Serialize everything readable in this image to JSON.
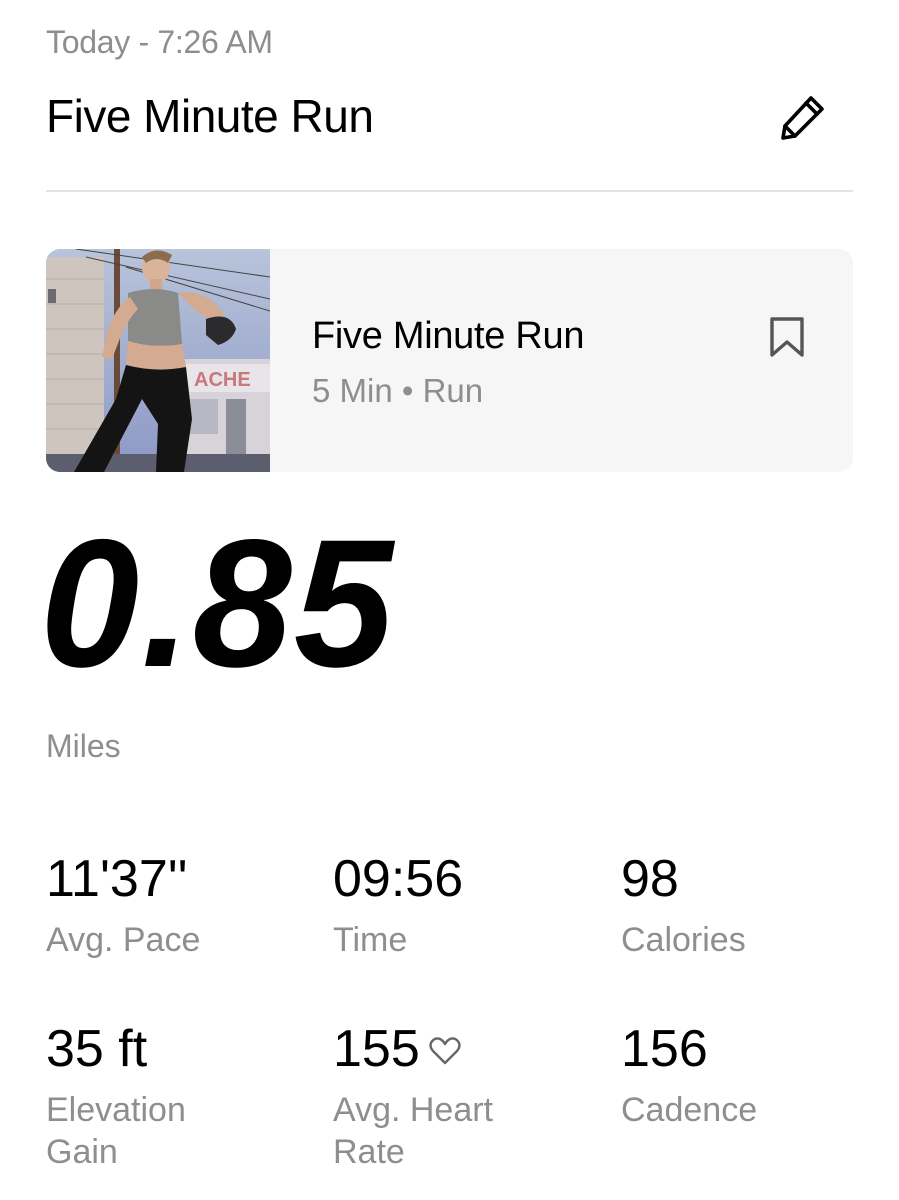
{
  "header": {
    "date_time": "Today - 7:26 AM",
    "title": "Five Minute Run",
    "edit_icon": "pencil-icon"
  },
  "workout_card": {
    "title": "Five Minute Run",
    "subtitle": "5 Min • Run",
    "thumbnail": "runner-photo",
    "bookmark_icon": "bookmark-icon"
  },
  "distance": {
    "value": "0.85",
    "unit": "Miles"
  },
  "stats": {
    "avg_pace": {
      "value": "11'37''",
      "label": "Avg. Pace"
    },
    "time": {
      "value": "09:56",
      "label": "Time"
    },
    "calories": {
      "value": "98",
      "label": "Calories"
    },
    "elevation": {
      "value": "35 ft",
      "label_line1": "Elevation",
      "label_line2": "Gain"
    },
    "heart_rate": {
      "value": "155",
      "label_line1": "Avg. Heart",
      "label_line2": "Rate",
      "icon": "heart-icon"
    },
    "cadence": {
      "value": "156",
      "label": "Cadence"
    }
  }
}
